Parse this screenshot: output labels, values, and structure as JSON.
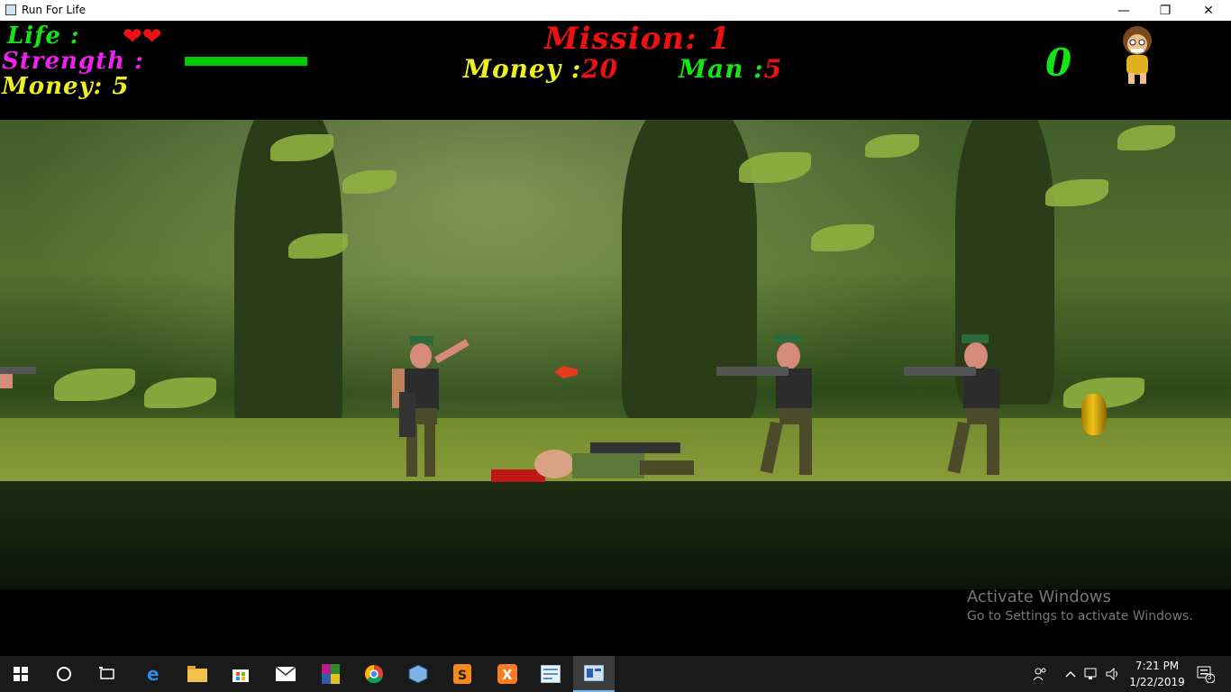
{
  "window": {
    "title": "Run For Life",
    "min_glyph": "—",
    "max_glyph": "❐",
    "close_glyph": "✕"
  },
  "hud": {
    "life_label": "Life :",
    "hearts": "❤❤",
    "strength_label": "Strength :",
    "strength_level": 1.0,
    "money_label": "Money:",
    "money_value": "5",
    "mission_label": "Mission:",
    "mission_value": "1",
    "shop_money_label": "Money :",
    "shop_money_value": "20",
    "man_label": "Man :",
    "man_value": "5",
    "score": "0"
  },
  "colors": {
    "life": "#15e515",
    "strength": "#ee22ee",
    "money": "#f0f020",
    "mission": "#ee1111",
    "strength_bar": "#00cc00"
  },
  "watermark": {
    "title": "Activate Windows",
    "subtitle": "Go to Settings to activate Windows."
  },
  "taskbar": {
    "apps": [
      "windows-start-icon",
      "search-circle-icon",
      "task-view-icon",
      "edge-icon",
      "file-explorer-icon",
      "store-icon",
      "mail-icon",
      "winrar-icon",
      "chrome-icon",
      "virtualbox-icon",
      "sublime-text-icon",
      "xampp-icon",
      "notepad-icon",
      "run-for-life-app-icon"
    ],
    "time": "7:21 PM",
    "date": "1/22/2019",
    "notification_count": "3"
  }
}
